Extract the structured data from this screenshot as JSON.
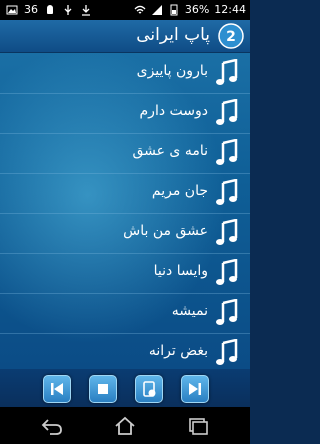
{
  "status_bar": {
    "notification_count": "36",
    "battery_percent": "36%",
    "time": "12:44"
  },
  "header": {
    "title": "پاپ ایرانی",
    "app_icon_badge": "2"
  },
  "songs": [
    "بارون پاییزی",
    "دوست دارم",
    "نامه ی عشق",
    "جان مریم",
    "عشق من باش",
    "وایسا دنیا",
    "نمیشه",
    "بغض ترانه"
  ],
  "controls": [
    "previous",
    "stop",
    "play-pause",
    "next"
  ],
  "icons": {
    "song": "music-note-icon",
    "previous": "skip-previous-icon",
    "stop": "stop-icon",
    "play_pause": "play-pause-icon",
    "next": "skip-next-icon"
  },
  "colors": {
    "title_bar": "#1a5e98",
    "list_background": "#0f5f97",
    "control_button": "#3f98d6"
  }
}
